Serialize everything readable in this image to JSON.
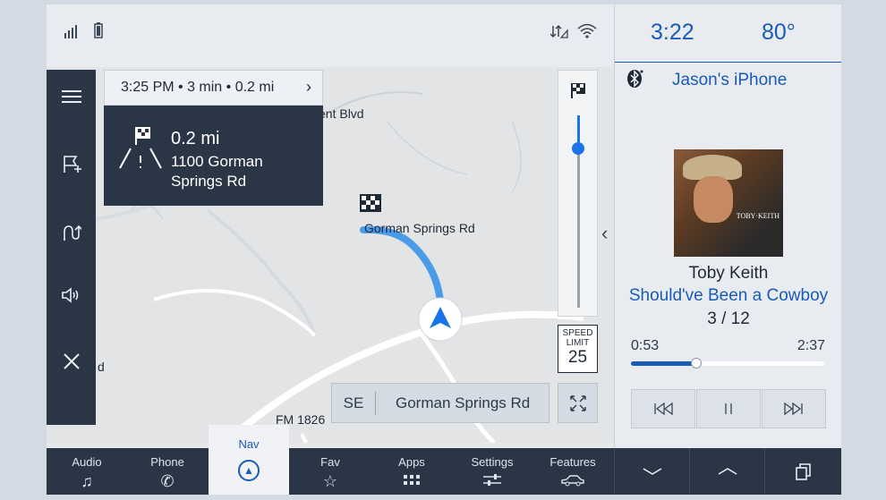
{
  "status": {
    "signal_icon": "signal-bars-icon",
    "phone_icon": "phone-battery-icon",
    "data_icon": "data-transfer-icon",
    "wifi_icon": "wifi-icon"
  },
  "nav": {
    "guidance": {
      "eta": "3:25 PM • 3 min • 0.2 mi",
      "distance": "0.2 mi",
      "address": "1100 Gorman Springs Rd"
    },
    "map_labels": {
      "street_partial": "ent Blvd",
      "destination_road": "Gorman Springs Rd",
      "fm_road": "FM 1826",
      "edge_d": "d"
    },
    "speed_limit": {
      "label": "SPEED LIMIT",
      "value": "25"
    },
    "current_road": {
      "direction": "SE",
      "name": "Gorman Springs Rd"
    },
    "left_menu": [
      "menu-icon",
      "add-destination-icon",
      "route-options-icon",
      "volume-icon",
      "close-icon"
    ]
  },
  "right_panel": {
    "time": "3:22",
    "temperature": "80°",
    "device": "Jason's iPhone",
    "album_text": "TOBY·KEITH",
    "artist": "Toby Keith",
    "song": "Should've Been a Cowboy",
    "track": "3 / 12",
    "elapsed": "0:53",
    "duration": "2:37",
    "progress_fraction": 0.34
  },
  "bottom_bar": {
    "items": [
      {
        "label": "Audio",
        "icon": "music-note-icon"
      },
      {
        "label": "Phone",
        "icon": "phone-icon"
      },
      {
        "label": "Nav",
        "icon": "navigation-icon"
      },
      {
        "label": "Fav",
        "icon": "star-add-icon"
      },
      {
        "label": "Apps",
        "icon": "apps-grid-icon"
      },
      {
        "label": "Settings",
        "icon": "sliders-icon"
      },
      {
        "label": "Features",
        "icon": "car-icon"
      }
    ]
  },
  "colors": {
    "accent": "#1a5bb8",
    "dark": "#2a3546",
    "route": "#4a9be8"
  }
}
